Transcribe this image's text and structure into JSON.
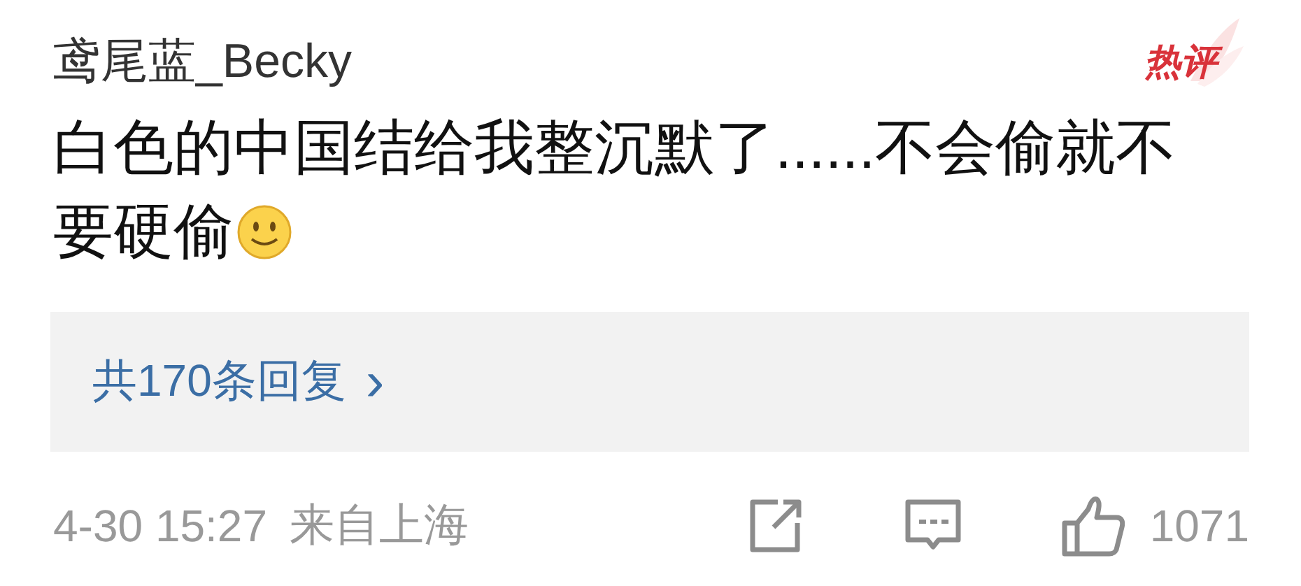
{
  "comment": {
    "username": "鸢尾蓝_Becky",
    "badge": "热评",
    "text_lines": [
      "白色的中国结给我整沉默了......不会偷就不",
      "要硬偷"
    ],
    "emoji": true
  },
  "replies": {
    "label": "共170条回复",
    "arrow": "›"
  },
  "footer": {
    "time": "4-30 15:27",
    "source": "来自上海",
    "likes": "1071"
  }
}
